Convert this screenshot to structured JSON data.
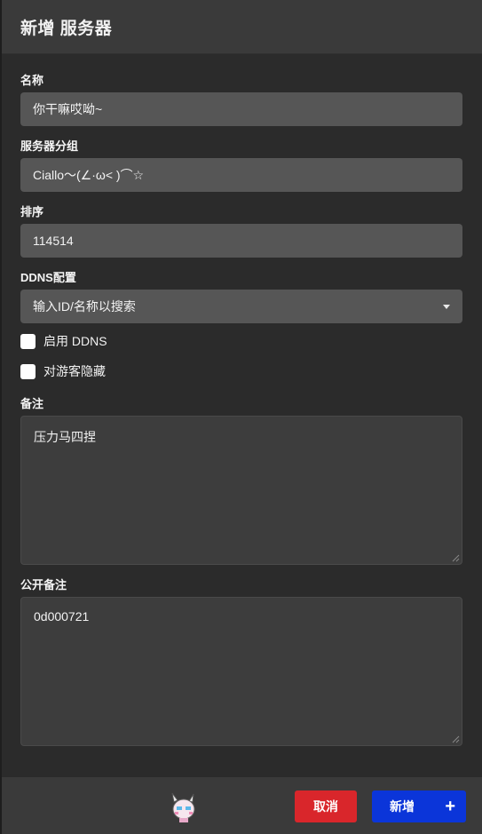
{
  "modal": {
    "title": "新增 服务器"
  },
  "form": {
    "name": {
      "label": "名称",
      "value": "你干嘛哎呦~"
    },
    "group": {
      "label": "服务器分组",
      "value": "Ciallo～(∠·ω< )⌒☆"
    },
    "order": {
      "label": "排序",
      "value": "114514"
    },
    "ddns": {
      "label": "DDNS配置",
      "placeholder": "输入ID/名称以搜索"
    },
    "enable_ddns": {
      "label": "启用 DDNS",
      "checked": false
    },
    "hide_guest": {
      "label": "对游客隐藏",
      "checked": false
    },
    "note": {
      "label": "备注",
      "value": "压力马四捏"
    },
    "public_note": {
      "label": "公开备注",
      "value": "0d000721"
    }
  },
  "footer": {
    "cancel_label": "取消",
    "add_label": "新增",
    "add_icon": "plus-icon",
    "cancel_color": "#d9262b",
    "add_color": "#0b35d9"
  }
}
